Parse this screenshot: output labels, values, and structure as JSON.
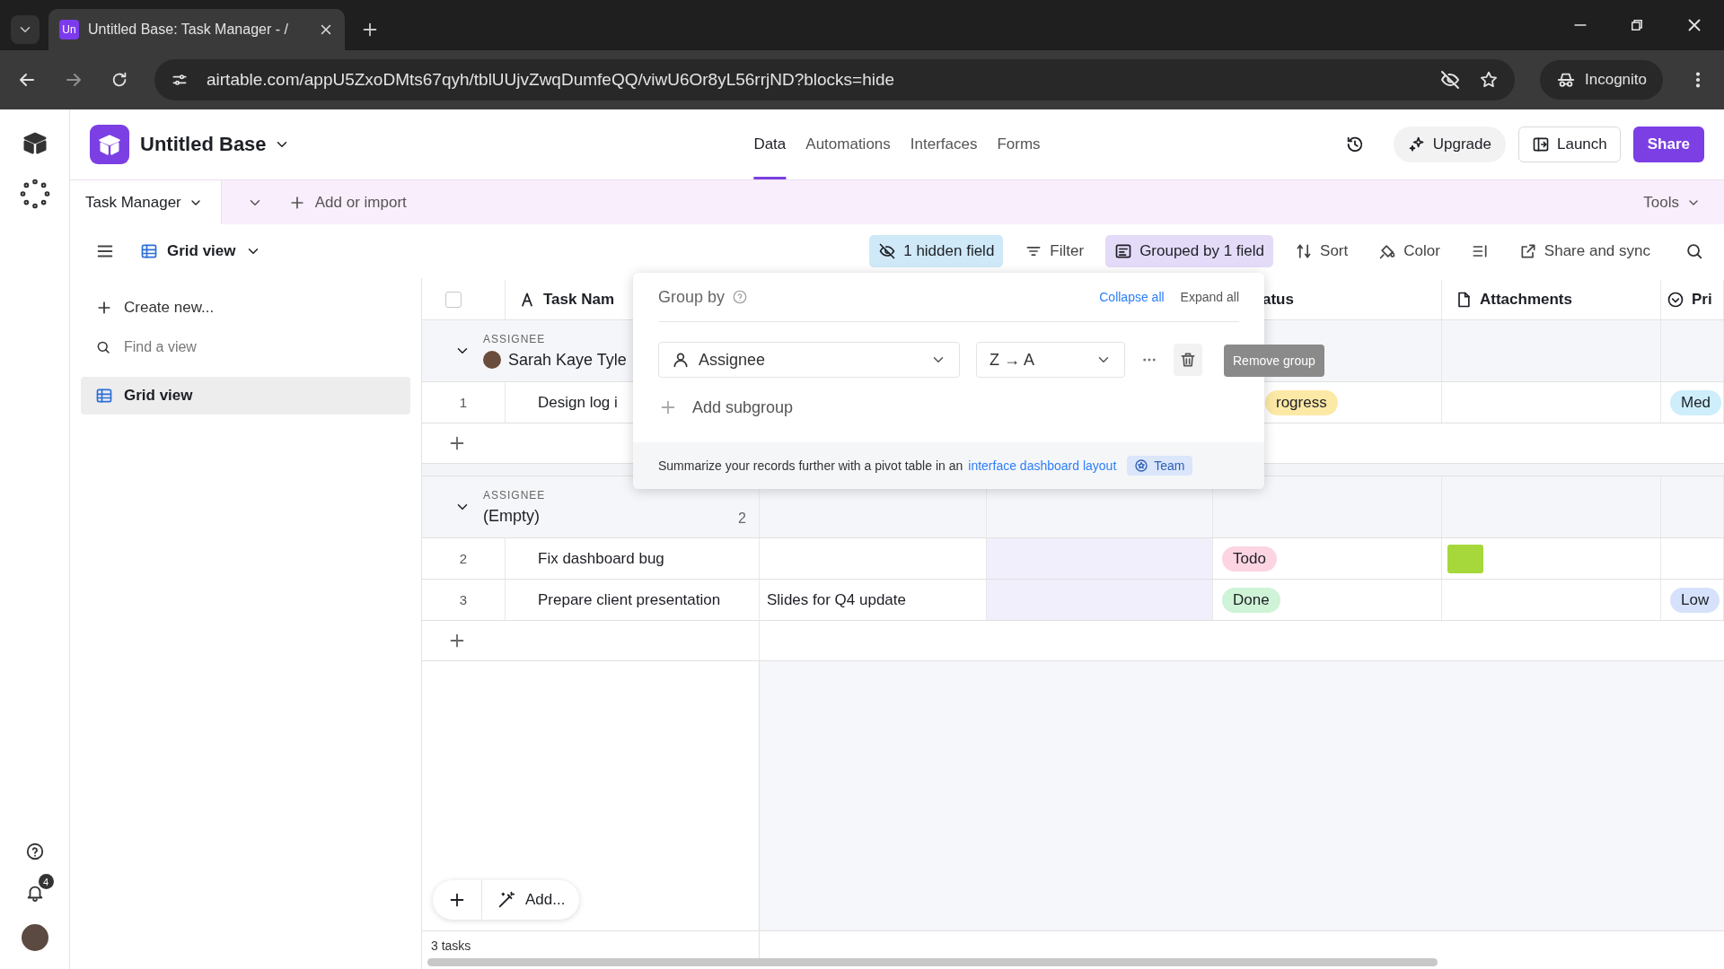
{
  "browser": {
    "favicon": "Un",
    "tab_title": "Untitled Base: Task Manager - /",
    "url": "airtable.com/appU5ZxoDMts67qyh/tblUUjvZwqDumfeQQ/viwU6Or8yL56rrjND?blocks=hide",
    "profile": "Incognito"
  },
  "rail": {
    "notification_count": "4"
  },
  "header": {
    "base_name": "Untitled Base",
    "nav": [
      {
        "label": "Data",
        "selected": true
      },
      {
        "label": "Automations",
        "selected": false
      },
      {
        "label": "Interfaces",
        "selected": false
      },
      {
        "label": "Forms",
        "selected": false
      }
    ],
    "upgrade": "Upgrade",
    "launch": "Launch",
    "share": "Share"
  },
  "table_bar": {
    "table": "Task Manager",
    "add": "Add or import",
    "tools": "Tools"
  },
  "view_bar": {
    "view": "Grid view",
    "actions": [
      {
        "kind": "hidden",
        "label": "1 hidden field",
        "active": true
      },
      {
        "kind": "filter",
        "label": "Filter",
        "active": false
      },
      {
        "kind": "group",
        "label": "Grouped by 1 field",
        "active": true
      },
      {
        "kind": "sort",
        "label": "Sort",
        "active": false
      },
      {
        "kind": "color",
        "label": "Color",
        "active": false
      },
      {
        "kind": "row_height",
        "active": false
      },
      {
        "kind": "share",
        "label": "Share and sync",
        "active": false
      }
    ]
  },
  "sidebar": {
    "create": "Create new...",
    "search": {
      "placeholder": "Find a view"
    },
    "views": [
      {
        "label": "Grid view",
        "selected": true
      }
    ]
  },
  "grid": {
    "select_all_checked": false,
    "columns": [
      {
        "kind": "name",
        "label": "Task Nam"
      },
      {
        "kind": "text"
      },
      {
        "kind": "blank",
        "highlighted": true
      },
      {
        "kind": "status",
        "label": "atus"
      },
      {
        "kind": "attachment",
        "label": "Attachments"
      },
      {
        "kind": "select",
        "label": "Pri"
      }
    ],
    "groups": [
      {
        "field_label": "ASSIGNEE",
        "value": "Sarah Kaye Tyle",
        "avatar": true,
        "expanded": true,
        "rows": [
          {
            "number": "1",
            "name": "Design log i",
            "status": {
              "label": "rogress",
              "color": "#fde9a6"
            },
            "attachment": false,
            "priority": {
              "label": "Med",
              "color": "#cdeefa"
            }
          }
        ]
      },
      {
        "field_label": "ASSIGNEE",
        "value": "(Empty)",
        "avatar": false,
        "count": "2",
        "expanded": true,
        "rows": [
          {
            "number": "2",
            "name": "Fix dashboard bug",
            "status": {
              "label": "Todo",
              "color": "#fcd4e2"
            },
            "attachment": true
          },
          {
            "number": "3",
            "name": "Prepare client presentation",
            "notes": "Slides for Q4 update",
            "status": {
              "label": "Done",
              "color": "#cff3d6"
            },
            "attachment": false,
            "priority": {
              "label": "Low",
              "color": "#d6e2fb"
            }
          }
        ]
      }
    ],
    "add_button": "Add...",
    "record_count": "3 tasks"
  },
  "popover": {
    "title": "Group by",
    "collapse_all": "Collapse all",
    "expand_all": "Expand all",
    "field": "Assignee",
    "order": "Z → A",
    "tooltip": "Remove group",
    "add_subgroup": "Add subgroup",
    "footer_text": "Summarize your records further with a pivot table in an",
    "footer_link": "interface dashboard layout",
    "plan_badge": "Team"
  }
}
